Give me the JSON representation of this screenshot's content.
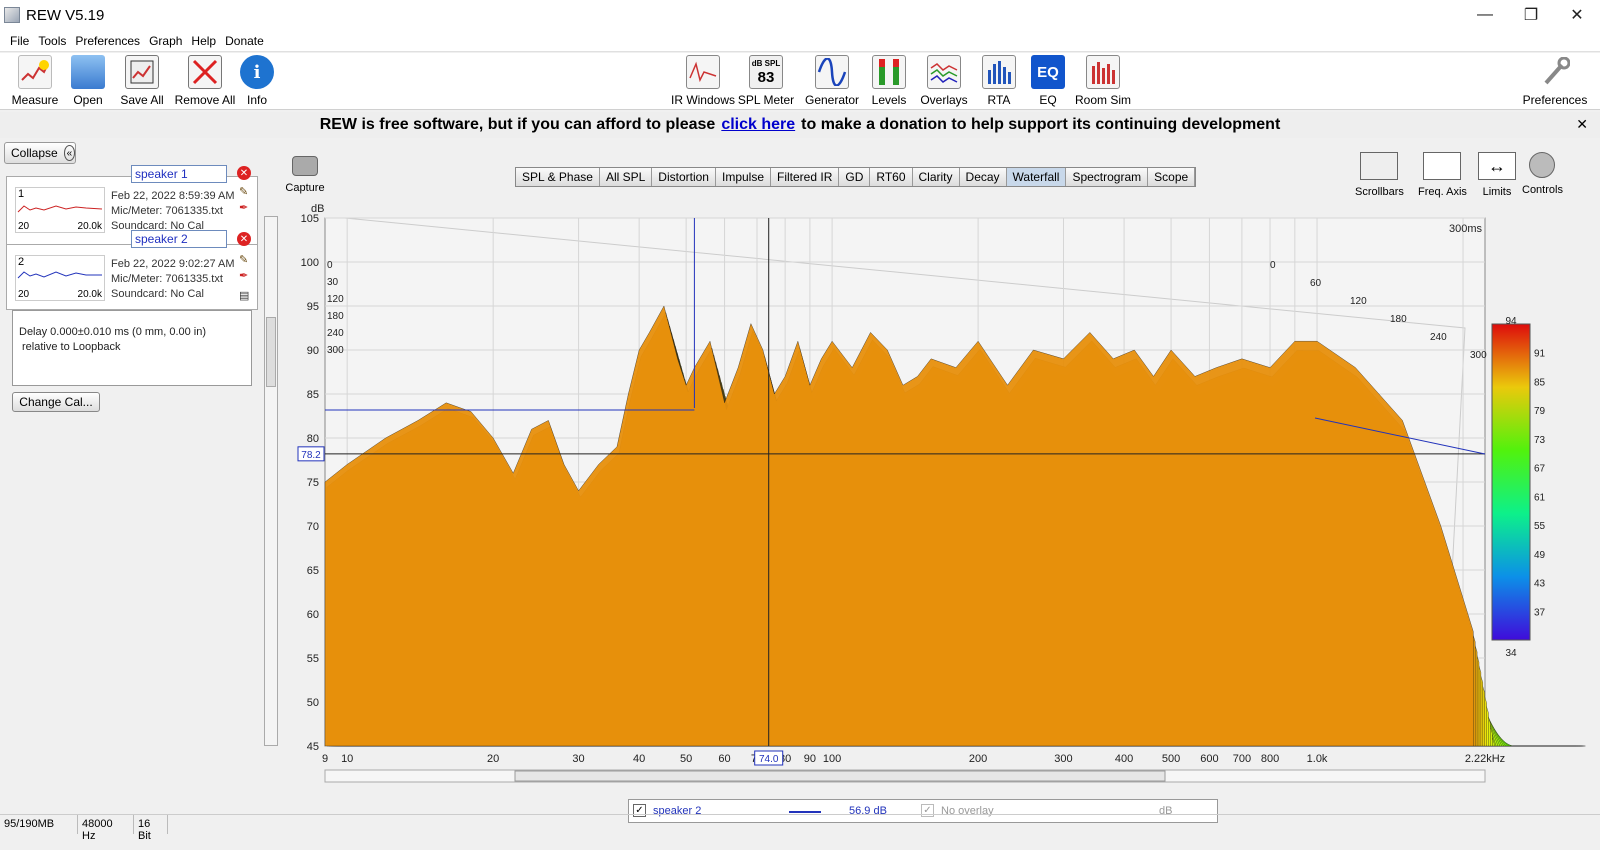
{
  "window": {
    "title": "REW V5.19"
  },
  "menu": [
    "File",
    "Tools",
    "Preferences",
    "Graph",
    "Help",
    "Donate"
  ],
  "toolbar": {
    "left": [
      {
        "label": "Measure",
        "icon": "measure-icon",
        "color": "#c43"
      },
      {
        "label": "Open",
        "icon": "folder-icon",
        "color": "#4a8fd8"
      },
      {
        "label": "Save All",
        "icon": "save-all-icon",
        "color": "#666"
      },
      {
        "label": "Remove All",
        "icon": "remove-all-icon",
        "color": "#c33"
      },
      {
        "label": "Info",
        "icon": "info-icon",
        "color": "#1e73d0"
      }
    ],
    "center": [
      {
        "label": "IR Windows",
        "icon": "ir-windows-icon",
        "color": "#c33"
      },
      {
        "label": "SPL Meter",
        "icon": "spl-meter-icon",
        "color": "#333",
        "text": "dB SPL\n83"
      },
      {
        "label": "Generator",
        "icon": "generator-icon",
        "color": "#2255bb"
      },
      {
        "label": "Levels",
        "icon": "levels-icon",
        "color": "#2a8a2a"
      },
      {
        "label": "Overlays",
        "icon": "overlays-icon",
        "color": "#aa3399"
      },
      {
        "label": "RTA",
        "icon": "rta-icon",
        "color": "#2255bb"
      },
      {
        "label": "EQ",
        "icon": "eq-icon",
        "color": "#1155cc"
      },
      {
        "label": "Room Sim",
        "icon": "room-sim-icon",
        "color": "#c33"
      }
    ],
    "right": {
      "label": "Preferences",
      "icon": "wrench-icon"
    }
  },
  "banner": {
    "text_before": "REW is free software, but if you can afford to please",
    "link": "click here",
    "text_after": "to make a donation to help support its continuing development"
  },
  "left": {
    "collapse_label": "Collapse",
    "measurements": [
      {
        "num": "1",
        "name": "speaker 1",
        "date": "Feb 22, 2022 8:59:39 AM",
        "mic": "Mic/Meter: 7061335.txt",
        "card": "Soundcard: No Cal",
        "thumb_lo": "20",
        "thumb_hi": "20.0k",
        "color": "#cc2222"
      },
      {
        "num": "2",
        "name": "speaker 2",
        "date": "Feb 22, 2022 9:02:27 AM",
        "mic": "Mic/Meter: 7061335.txt",
        "card": "Soundcard: No Cal",
        "thumb_lo": "20",
        "thumb_hi": "20.0k",
        "color": "#2233bb"
      }
    ],
    "delay_line1": "Delay 0.000±0.010 ms (0 mm, 0.00 in)",
    "delay_line2": "relative to Loopback",
    "change_cal": "Change Cal..."
  },
  "capture_label": "Capture",
  "graph_tabs": [
    "SPL & Phase",
    "All SPL",
    "Distortion",
    "Impulse",
    "Filtered IR",
    "GD",
    "RT60",
    "Clarity",
    "Decay",
    "Waterfall",
    "Spectrogram",
    "Scope"
  ],
  "active_tab": "Waterfall",
  "right_tools": [
    "Scrollbars",
    "Freq. Axis",
    "Limits",
    "Controls"
  ],
  "chart_data": {
    "type": "area",
    "title": "",
    "ylabel": "dB",
    "xlabel": "",
    "y_ticks": [
      105,
      100,
      95,
      90,
      85,
      80,
      75,
      70,
      65,
      60,
      55,
      50,
      45
    ],
    "ylim": [
      45,
      105
    ],
    "x_ticks": [
      "9",
      "10",
      "20",
      "30",
      "40",
      "50",
      "60",
      "70",
      "80",
      "90",
      "100",
      "200",
      "300",
      "400",
      "500",
      "600",
      "700",
      "800",
      "1.0k",
      "2.22kHz"
    ],
    "xlim_hz": [
      9,
      2220
    ],
    "x_scale": "log",
    "time_ticks_ms": [
      "0",
      "60",
      "120",
      "180",
      "240",
      "300"
    ],
    "time_ticks_left": [
      "0",
      "30",
      "120",
      "180",
      "240",
      "300"
    ],
    "time_end_label": "300ms",
    "cursor": {
      "y_readout": "78.2",
      "x_readout": "74.0"
    },
    "colorbar": {
      "ticks": [
        "94",
        "91",
        "85",
        "79",
        "73",
        "67",
        "61",
        "55",
        "49",
        "43",
        "37",
        "34"
      ],
      "min": 34,
      "max": 94
    },
    "front_series": {
      "name": "speaker 2",
      "x": [
        9,
        10,
        12,
        14,
        16,
        18,
        20,
        22,
        24,
        26,
        28,
        30,
        33,
        36,
        38,
        40,
        42,
        45,
        48,
        50,
        52,
        56,
        60,
        64,
        68,
        72,
        76,
        80,
        85,
        90,
        95,
        100,
        110,
        120,
        130,
        140,
        150,
        160,
        180,
        200,
        230,
        260,
        300,
        340,
        380,
        420,
        460,
        500,
        560,
        620,
        700,
        800,
        900,
        1000,
        1200,
        1500,
        1800,
        2100
      ],
      "y": [
        75,
        77,
        80,
        82,
        84,
        83,
        80,
        76,
        81,
        82,
        77,
        74,
        77,
        79,
        85,
        90,
        92,
        95,
        89,
        86,
        88,
        91,
        84,
        88,
        93,
        90,
        85,
        87,
        91,
        86,
        89,
        91,
        88,
        92,
        90,
        86,
        87,
        89,
        88,
        91,
        86,
        90,
        89,
        92,
        89,
        90,
        87,
        90,
        87,
        88,
        89,
        88,
        91,
        91,
        88,
        82,
        70,
        58
      ]
    },
    "slices": 60,
    "decay_db_per_slice": 0.72
  },
  "legend": {
    "series_name": "speaker 2",
    "series_value": "56.9 dB",
    "overlay_label": "No overlay",
    "overlay_unit": "dB",
    "series_color": "#2233bb"
  },
  "status": [
    "95/190MB",
    "48000 Hz",
    "16 Bit"
  ]
}
